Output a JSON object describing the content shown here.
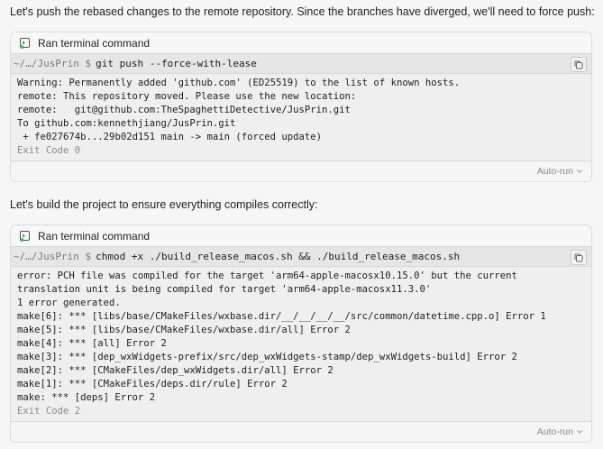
{
  "messages": {
    "first": "Let's push the rebased changes to the remote repository. Since the branches have diverged, we'll need to force push:",
    "second": "Let's build the project to ensure everything compiles correctly:"
  },
  "blocks": [
    {
      "header": "Ran terminal command",
      "prompt": "~/…/JusPrin $",
      "command": "git push --force-with-lease",
      "output": [
        "Warning: Permanently added 'github.com' (ED25519) to the list of known hosts.",
        "remote: This repository moved. Please use the new location:",
        "remote:   git@github.com:TheSpaghettiDetective/JusPrin.git",
        "To github.com:kennethjiang/JusPrin.git",
        " + fe027674b...29b02d151 main -> main (forced update)"
      ],
      "exit": "Exit Code 0",
      "footer": "Auto-run"
    },
    {
      "header": "Ran terminal command",
      "prompt": "~/…/JusPrin $",
      "command": "chmod +x ./build_release_macos.sh && ./build_release_macos.sh",
      "output": [
        "error: PCH file was compiled for the target 'arm64-apple-macosx10.15.0' but the current translation unit is being compiled for target 'arm64-apple-macosx11.3.0'",
        "1 error generated.",
        "make[6]: *** [libs/base/CMakeFiles/wxbase.dir/__/__/__/__/src/common/datetime.cpp.o] Error 1",
        "make[5]: *** [libs/base/CMakeFiles/wxbase.dir/all] Error 2",
        "make[4]: *** [all] Error 2",
        "make[3]: *** [dep_wxWidgets-prefix/src/dep_wxWidgets-stamp/dep_wxWidgets-build] Error 2",
        "make[2]: *** [CMakeFiles/dep_wxWidgets.dir/all] Error 2",
        "make[1]: *** [CMakeFiles/deps.dir/rule] Error 2",
        "make: *** [deps] Error 2"
      ],
      "exit": "Exit Code 2",
      "footer": "Auto-run"
    }
  ],
  "icons": {
    "terminal": "terminal-icon",
    "copy": "copy-icon",
    "chevron": "chevron-down-icon"
  },
  "colors": {
    "status_dot": "#3fb950"
  }
}
